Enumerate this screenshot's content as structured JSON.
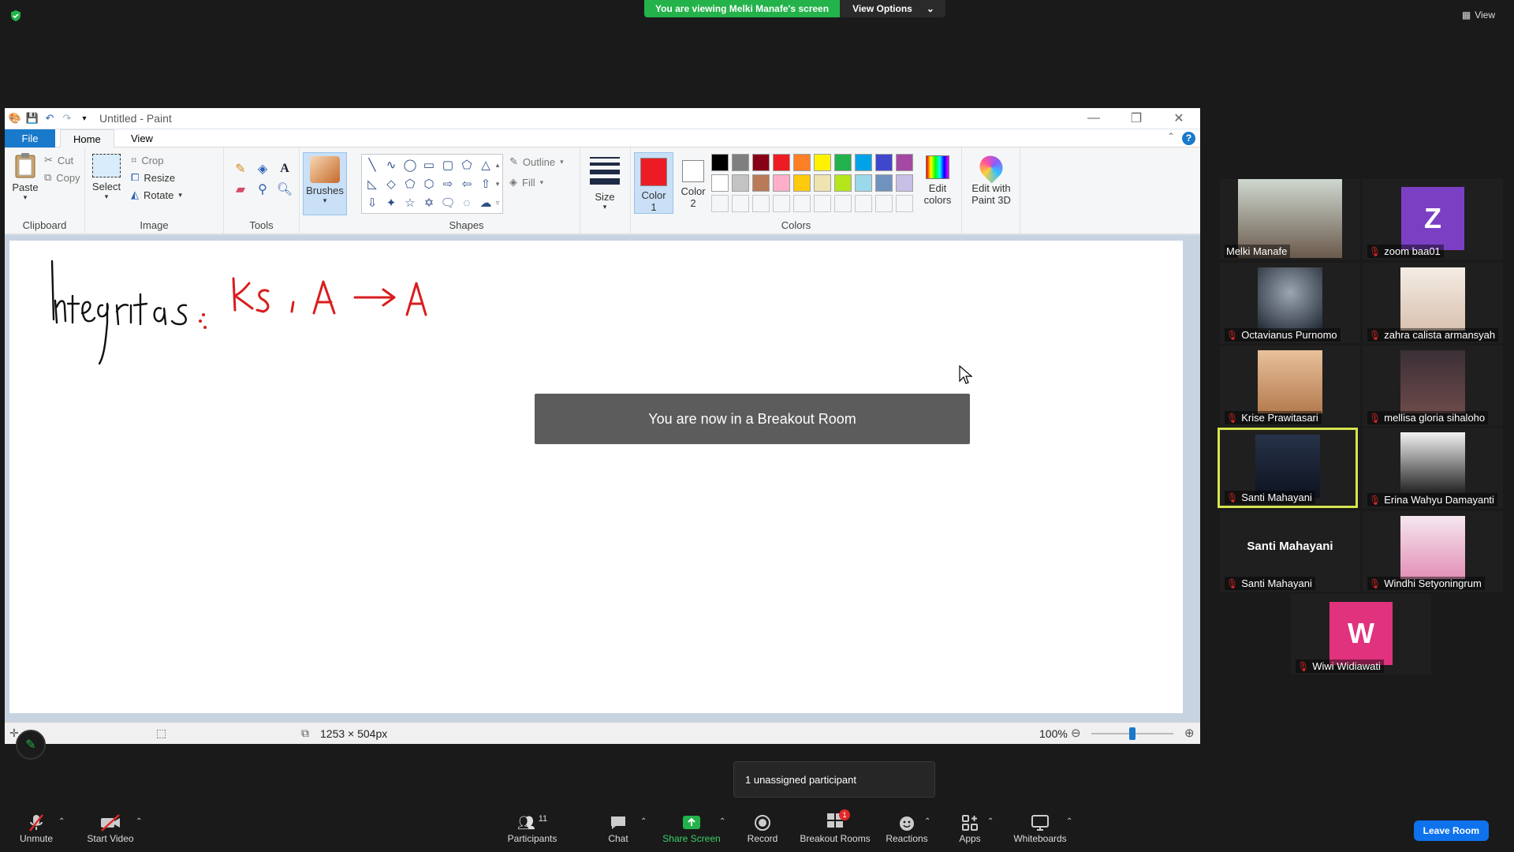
{
  "zoom": {
    "viewing_banner": "You are viewing Melki Manafe's screen",
    "view_options": "View Options",
    "view_label": "View",
    "toast": "You are now in a Breakout Room",
    "unassigned_tooltip": "1 unassigned participant",
    "participants_count": "11",
    "breakout_badge": "1",
    "toolbar": {
      "unmute": "Unmute",
      "start_video": "Start Video",
      "participants": "Participants",
      "chat": "Chat",
      "share_screen": "Share Screen",
      "record": "Record",
      "breakout_rooms": "Breakout Rooms",
      "reactions": "Reactions",
      "apps": "Apps",
      "whiteboards": "Whiteboards",
      "leave_room": "Leave Room"
    },
    "participants": [
      {
        "name": "Melki Manafe",
        "muted": false,
        "type": "photo"
      },
      {
        "name": "zoom baa01",
        "muted": true,
        "type": "letter",
        "letter": "Z",
        "color": "#7b3fc4"
      },
      {
        "name": "Octavianus Purnomo",
        "muted": true,
        "type": "photo"
      },
      {
        "name": "zahra calista armansyah",
        "muted": true,
        "type": "photo"
      },
      {
        "name": "Krise Prawitasari",
        "muted": true,
        "type": "photo"
      },
      {
        "name": "mellisa gloria sihaloho",
        "muted": true,
        "type": "photo"
      },
      {
        "name": "Santi Mahayani",
        "muted": true,
        "type": "photo",
        "active": true
      },
      {
        "name": "Erina Wahyu Damayanti",
        "muted": true,
        "type": "photo"
      },
      {
        "name": "Santi Mahayani",
        "muted": true,
        "type": "name",
        "display": "Santi Mahayani"
      },
      {
        "name": "Windhi Setyoningrum",
        "muted": true,
        "type": "photo"
      },
      {
        "name": "Wiwi Widiawati",
        "muted": true,
        "type": "letter",
        "letter": "W",
        "color": "#e0327d"
      }
    ]
  },
  "paint": {
    "title": "Untitled - Paint",
    "tabs": [
      "File",
      "Home",
      "View"
    ],
    "clipboard": {
      "paste": "Paste",
      "cut": "Cut",
      "copy": "Copy",
      "label": "Clipboard"
    },
    "image": {
      "select": "Select",
      "crop": "Crop",
      "resize": "Resize",
      "rotate": "Rotate",
      "label": "Image"
    },
    "tools": {
      "label": "Tools"
    },
    "brushes": "Brushes",
    "shapes": {
      "outline": "Outline",
      "fill": "Fill",
      "label": "Shapes"
    },
    "size": "Size",
    "color1": {
      "label1": "Color",
      "label2": "1",
      "value": "#ed1c24"
    },
    "color2": {
      "label1": "Color",
      "label2": "2",
      "value": "#ffffff"
    },
    "colors_label": "Colors",
    "edit_colors": {
      "line1": "Edit",
      "line2": "colors"
    },
    "paint3d": {
      "line1": "Edit with",
      "line2": "Paint 3D"
    },
    "palette_row1": [
      "#000000",
      "#7f7f7f",
      "#880015",
      "#ed1c24",
      "#ff7f27",
      "#fff200",
      "#22b14c",
      "#00a2e8",
      "#3f48cc",
      "#a349a4"
    ],
    "palette_row2": [
      "#ffffff",
      "#c3c3c3",
      "#b97a57",
      "#ffaec9",
      "#ffc90e",
      "#efe4b0",
      "#b5e61d",
      "#99d9ea",
      "#7092be",
      "#c8bfe7"
    ],
    "status": {
      "dimensions": "1253 × 504px",
      "zoom": "100%"
    }
  }
}
